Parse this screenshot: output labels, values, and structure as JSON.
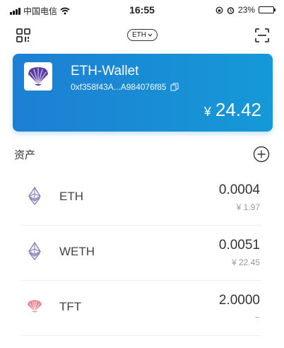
{
  "status_bar": {
    "carrier": "中国电信",
    "time": "16:55",
    "battery": "23%",
    "battery_level": 0.23
  },
  "top_nav": {
    "network": "ETH"
  },
  "wallet": {
    "name": "ETH-Wallet",
    "address": "0xf358f43A...A984076f85",
    "currency_symbol": "¥",
    "balance": "24.42",
    "accent": "#1a8ad6"
  },
  "assets": {
    "title": "资产",
    "items": [
      {
        "symbol": "ETH",
        "amount": "0.0004",
        "value": "¥ 1.97",
        "icon": "ethereum-icon"
      },
      {
        "symbol": "WETH",
        "amount": "0.0051",
        "value": "¥ 22.45",
        "icon": "ethereum-icon"
      },
      {
        "symbol": "TFT",
        "amount": "2.0000",
        "value": "~",
        "icon": "shell-icon"
      }
    ]
  }
}
